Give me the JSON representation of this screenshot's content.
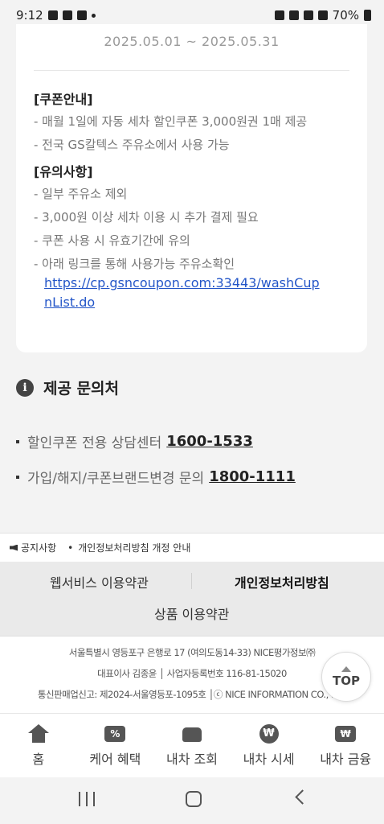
{
  "status_bar": {
    "time": "9:12",
    "battery": "70%"
  },
  "coupon": {
    "period": "2025.05.01 ~ 2025.05.31",
    "guide_title": "[쿠폰안내]",
    "guide_items": [
      "- 매월 1일에 자동 세차 할인쿠폰 3,000원권 1매 제공",
      "- 전국 GS칼텍스 주유소에서 사용 가능"
    ],
    "caution_title": "[유의사항]",
    "caution_items": [
      "- 일부 주유소 제외",
      "- 3,000원 이상 세차 이용 시 추가 결제 필요",
      "- 쿠폰 사용 시 유효기간에 유의",
      "- 아래 링크를 통해 사용가능 주유소확인"
    ],
    "link_line1": "https://cp.gsncoupon.com:33443/washCup",
    "link_line2": "nList.do"
  },
  "contact": {
    "title": "제공 문의처",
    "rows": [
      {
        "label": "할인쿠폰 전용 상담센터",
        "phone": "1600-1533"
      },
      {
        "label": "가입/해지/쿠폰브랜드변경 문의",
        "phone": "1800-1111"
      }
    ]
  },
  "notice": {
    "label": "공지사항",
    "item": "개인정보처리방침 개정 안내"
  },
  "footer_links": {
    "web_terms": "웹서비스 이용약관",
    "privacy": "개인정보처리방침",
    "product_terms": "상품 이용약관"
  },
  "company": {
    "line1": "서울특별시 영등포구 은행로 17 (여의도동14-33) NICE평가정보㈜",
    "line2": "대표이사 김종윤 │ 사업자등록번호 116-81-15020",
    "line3": "통신판매업신고: 제2024-서울영등포-1095호 │ⓒ NICE INFORMATION CO., LTD"
  },
  "top_button": "TOP",
  "bottom_nav": [
    {
      "label": "홈",
      "icon": "home-icon"
    },
    {
      "label": "케어 혜택",
      "icon": "coupon-icon"
    },
    {
      "label": "내차 조회",
      "icon": "car-icon"
    },
    {
      "label": "내차 시세",
      "icon": "won-coin-icon"
    },
    {
      "label": "내차 금융",
      "icon": "car-finance-icon"
    }
  ],
  "icons": {
    "info": "i",
    "coupon_glyph": "%",
    "won_glyph": "₩"
  }
}
